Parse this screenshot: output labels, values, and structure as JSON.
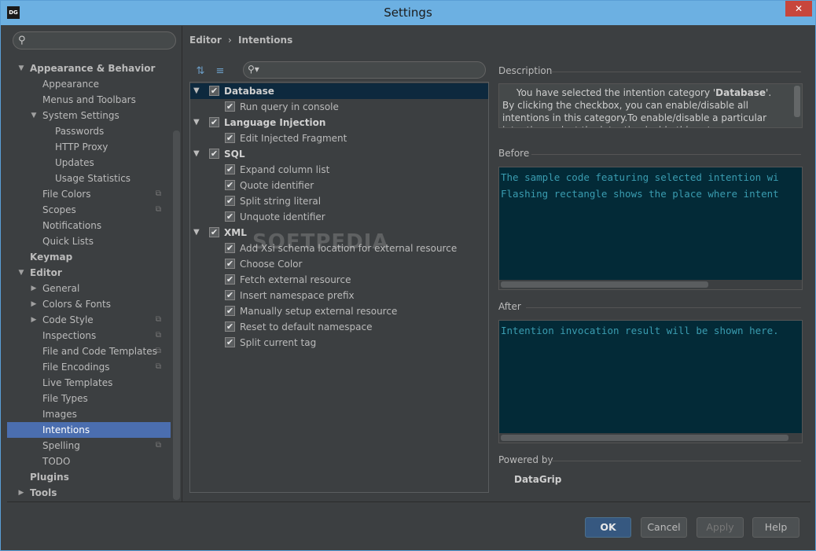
{
  "window": {
    "title": "Settings",
    "app_icon": "DG",
    "close": "✕"
  },
  "nav": {
    "search_placeholder": "",
    "items": [
      {
        "label": "Appearance & Behavior",
        "bold": true,
        "expanded": true
      },
      {
        "label": "Appearance"
      },
      {
        "label": "Menus and Toolbars"
      },
      {
        "label": "System Settings",
        "expanded": true
      },
      {
        "label": "Passwords"
      },
      {
        "label": "HTTP Proxy"
      },
      {
        "label": "Updates"
      },
      {
        "label": "Usage Statistics"
      },
      {
        "label": "File Colors",
        "copy_icon": true
      },
      {
        "label": "Scopes",
        "copy_icon": true
      },
      {
        "label": "Notifications"
      },
      {
        "label": "Quick Lists"
      },
      {
        "label": "Keymap",
        "bold": true
      },
      {
        "label": "Editor",
        "bold": true,
        "expanded": true
      },
      {
        "label": "General",
        "expanded": false
      },
      {
        "label": "Colors & Fonts",
        "expanded": false
      },
      {
        "label": "Code Style",
        "expanded": false,
        "copy_icon": true
      },
      {
        "label": "Inspections",
        "copy_icon": true
      },
      {
        "label": "File and Code Templates",
        "copy_icon": true
      },
      {
        "label": "File Encodings",
        "copy_icon": true
      },
      {
        "label": "Live Templates"
      },
      {
        "label": "File Types"
      },
      {
        "label": "Images"
      },
      {
        "label": "Intentions",
        "selected": true
      },
      {
        "label": "Spelling",
        "copy_icon": true
      },
      {
        "label": "TODO"
      },
      {
        "label": "Plugins",
        "bold": true
      },
      {
        "label": "Tools",
        "bold": true,
        "expanded": false
      }
    ]
  },
  "breadcrumb": {
    "part1": "Editor",
    "sep": "›",
    "part2": "Intentions"
  },
  "toolbar": {
    "expand_all": "expand-all-icon",
    "collapse_all": "collapse-all-icon",
    "filter_placeholder": ""
  },
  "tree": [
    {
      "label": "Database",
      "category": true,
      "checked": true,
      "selected": true
    },
    {
      "label": "Run query in console",
      "checked": true
    },
    {
      "label": "Language Injection",
      "category": true,
      "checked": true
    },
    {
      "label": "Edit Injected Fragment",
      "checked": true
    },
    {
      "label": "SQL",
      "category": true,
      "checked": true
    },
    {
      "label": "Expand column list",
      "checked": true
    },
    {
      "label": "Quote identifier",
      "checked": true
    },
    {
      "label": "Split string literal",
      "checked": true
    },
    {
      "label": "Unquote identifier",
      "checked": true
    },
    {
      "label": "XML",
      "category": true,
      "checked": true
    },
    {
      "label": "Add Xsi schema location for external resource",
      "checked": true
    },
    {
      "label": "Choose Color",
      "checked": true
    },
    {
      "label": "Fetch external resource",
      "checked": true
    },
    {
      "label": "Insert namespace prefix",
      "checked": true
    },
    {
      "label": "Manually setup external resource",
      "checked": true
    },
    {
      "label": "Reset to default namespace",
      "checked": true
    },
    {
      "label": "Split current tag",
      "checked": true
    }
  ],
  "watermark": "SOFTPEDIA",
  "description": {
    "title": "Description",
    "line1_pre": "You have selected the intention category '",
    "line1_bold": "Database",
    "line1_post": "'.",
    "body": "By clicking the checkbox, you can enable/disable all intentions in this category.To enable/disable a particular intention, select the intention inside this category."
  },
  "before": {
    "title": "Before",
    "lines": [
      "The sample code featuring selected intention wi",
      "Flashing rectangle shows the place where intent"
    ]
  },
  "after": {
    "title": "After",
    "lines": [
      "Intention invocation result will be shown here."
    ]
  },
  "powered_by": {
    "title": "Powered by",
    "name": "DataGrip"
  },
  "buttons": {
    "ok": "OK",
    "cancel": "Cancel",
    "apply": "Apply",
    "help": "Help"
  }
}
